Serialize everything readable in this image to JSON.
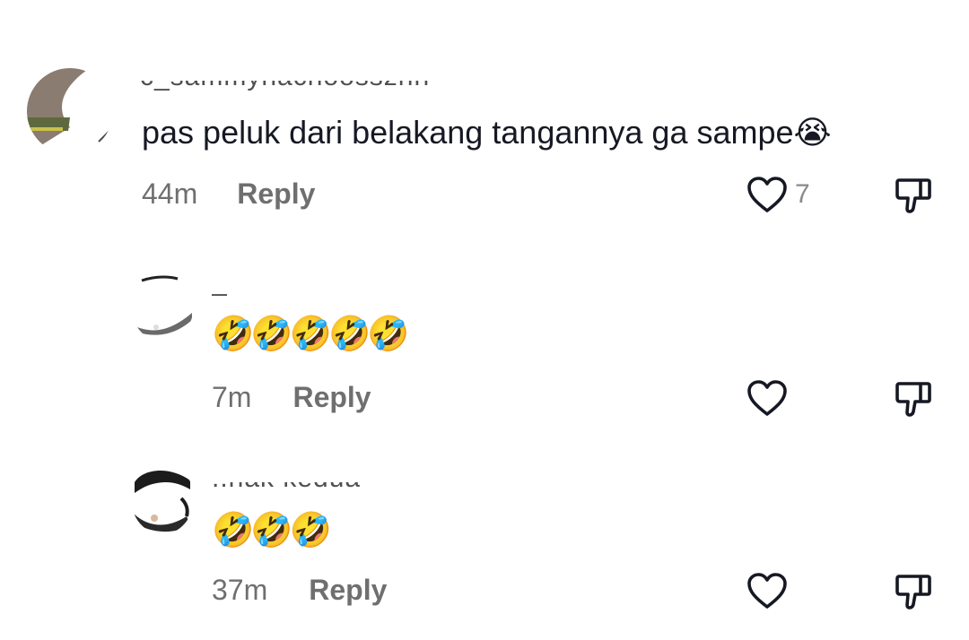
{
  "comments": [
    {
      "username": "c_sammynachoossznn",
      "text": "pas peluk dari belakang tangannya ga sampe😭",
      "time": "44m",
      "reply_label": "Reply",
      "likes": "7"
    },
    {
      "username": "_",
      "text": "🤣🤣🤣🤣🤣",
      "time": "7m",
      "reply_label": "Reply",
      "likes": ""
    },
    {
      "username": "..nak kedua",
      "text": "🤣🤣🤣",
      "time": "37m",
      "reply_label": "Reply",
      "likes": ""
    }
  ],
  "icons": {
    "like": "heart-outline-icon",
    "dislike": "thumbs-down-outline-icon"
  },
  "colors": {
    "text": "#161823",
    "secondary": "#6f6f6f",
    "icon": "#161823"
  }
}
